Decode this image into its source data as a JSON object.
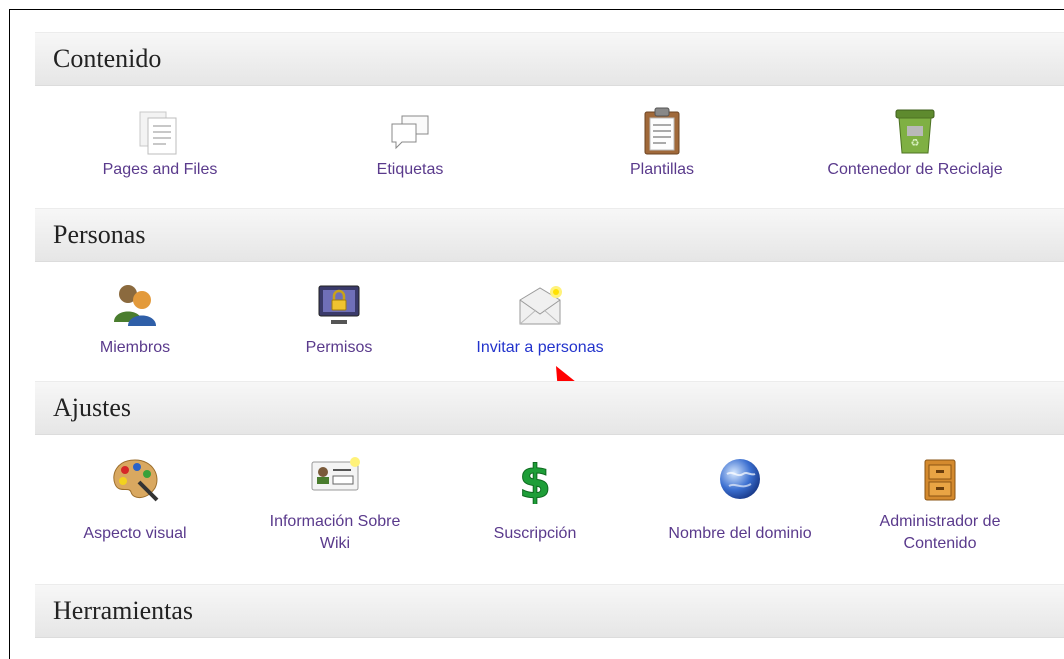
{
  "sections": {
    "contenido": {
      "title": "Contenido",
      "items": [
        {
          "label": "Pages and Files",
          "icon": "pages-files-icon"
        },
        {
          "label": "Etiquetas",
          "icon": "tags-speech-bubbles-icon"
        },
        {
          "label": "Plantillas",
          "icon": "clipboard-icon"
        },
        {
          "label": "Contenedor de Reciclaje",
          "icon": "recycle-bin-icon"
        }
      ]
    },
    "personas": {
      "title": "Personas",
      "items": [
        {
          "label": "Miembros",
          "icon": "members-icon"
        },
        {
          "label": "Permisos",
          "icon": "lock-monitor-icon"
        },
        {
          "label": "Invitar a personas",
          "icon": "envelope-icon"
        }
      ]
    },
    "ajustes": {
      "title": "Ajustes",
      "items": [
        {
          "label": "Aspecto visual",
          "icon": "paint-palette-icon"
        },
        {
          "label_line1": "Información Sobre",
          "label_line2": "Wiki",
          "icon": "id-card-icon"
        },
        {
          "label": "Suscripción",
          "icon": "dollar-icon"
        },
        {
          "label": "Nombre del dominio",
          "icon": "globe-icon"
        },
        {
          "label_line1": "Administrador de",
          "label_line2": "Contenido",
          "icon": "cabinet-icon"
        }
      ]
    },
    "herramientas": {
      "title": "Herramientas"
    }
  },
  "colors": {
    "link": "#5a3a8c",
    "link_active": "#2233cc",
    "arrow": "#ff0000"
  }
}
